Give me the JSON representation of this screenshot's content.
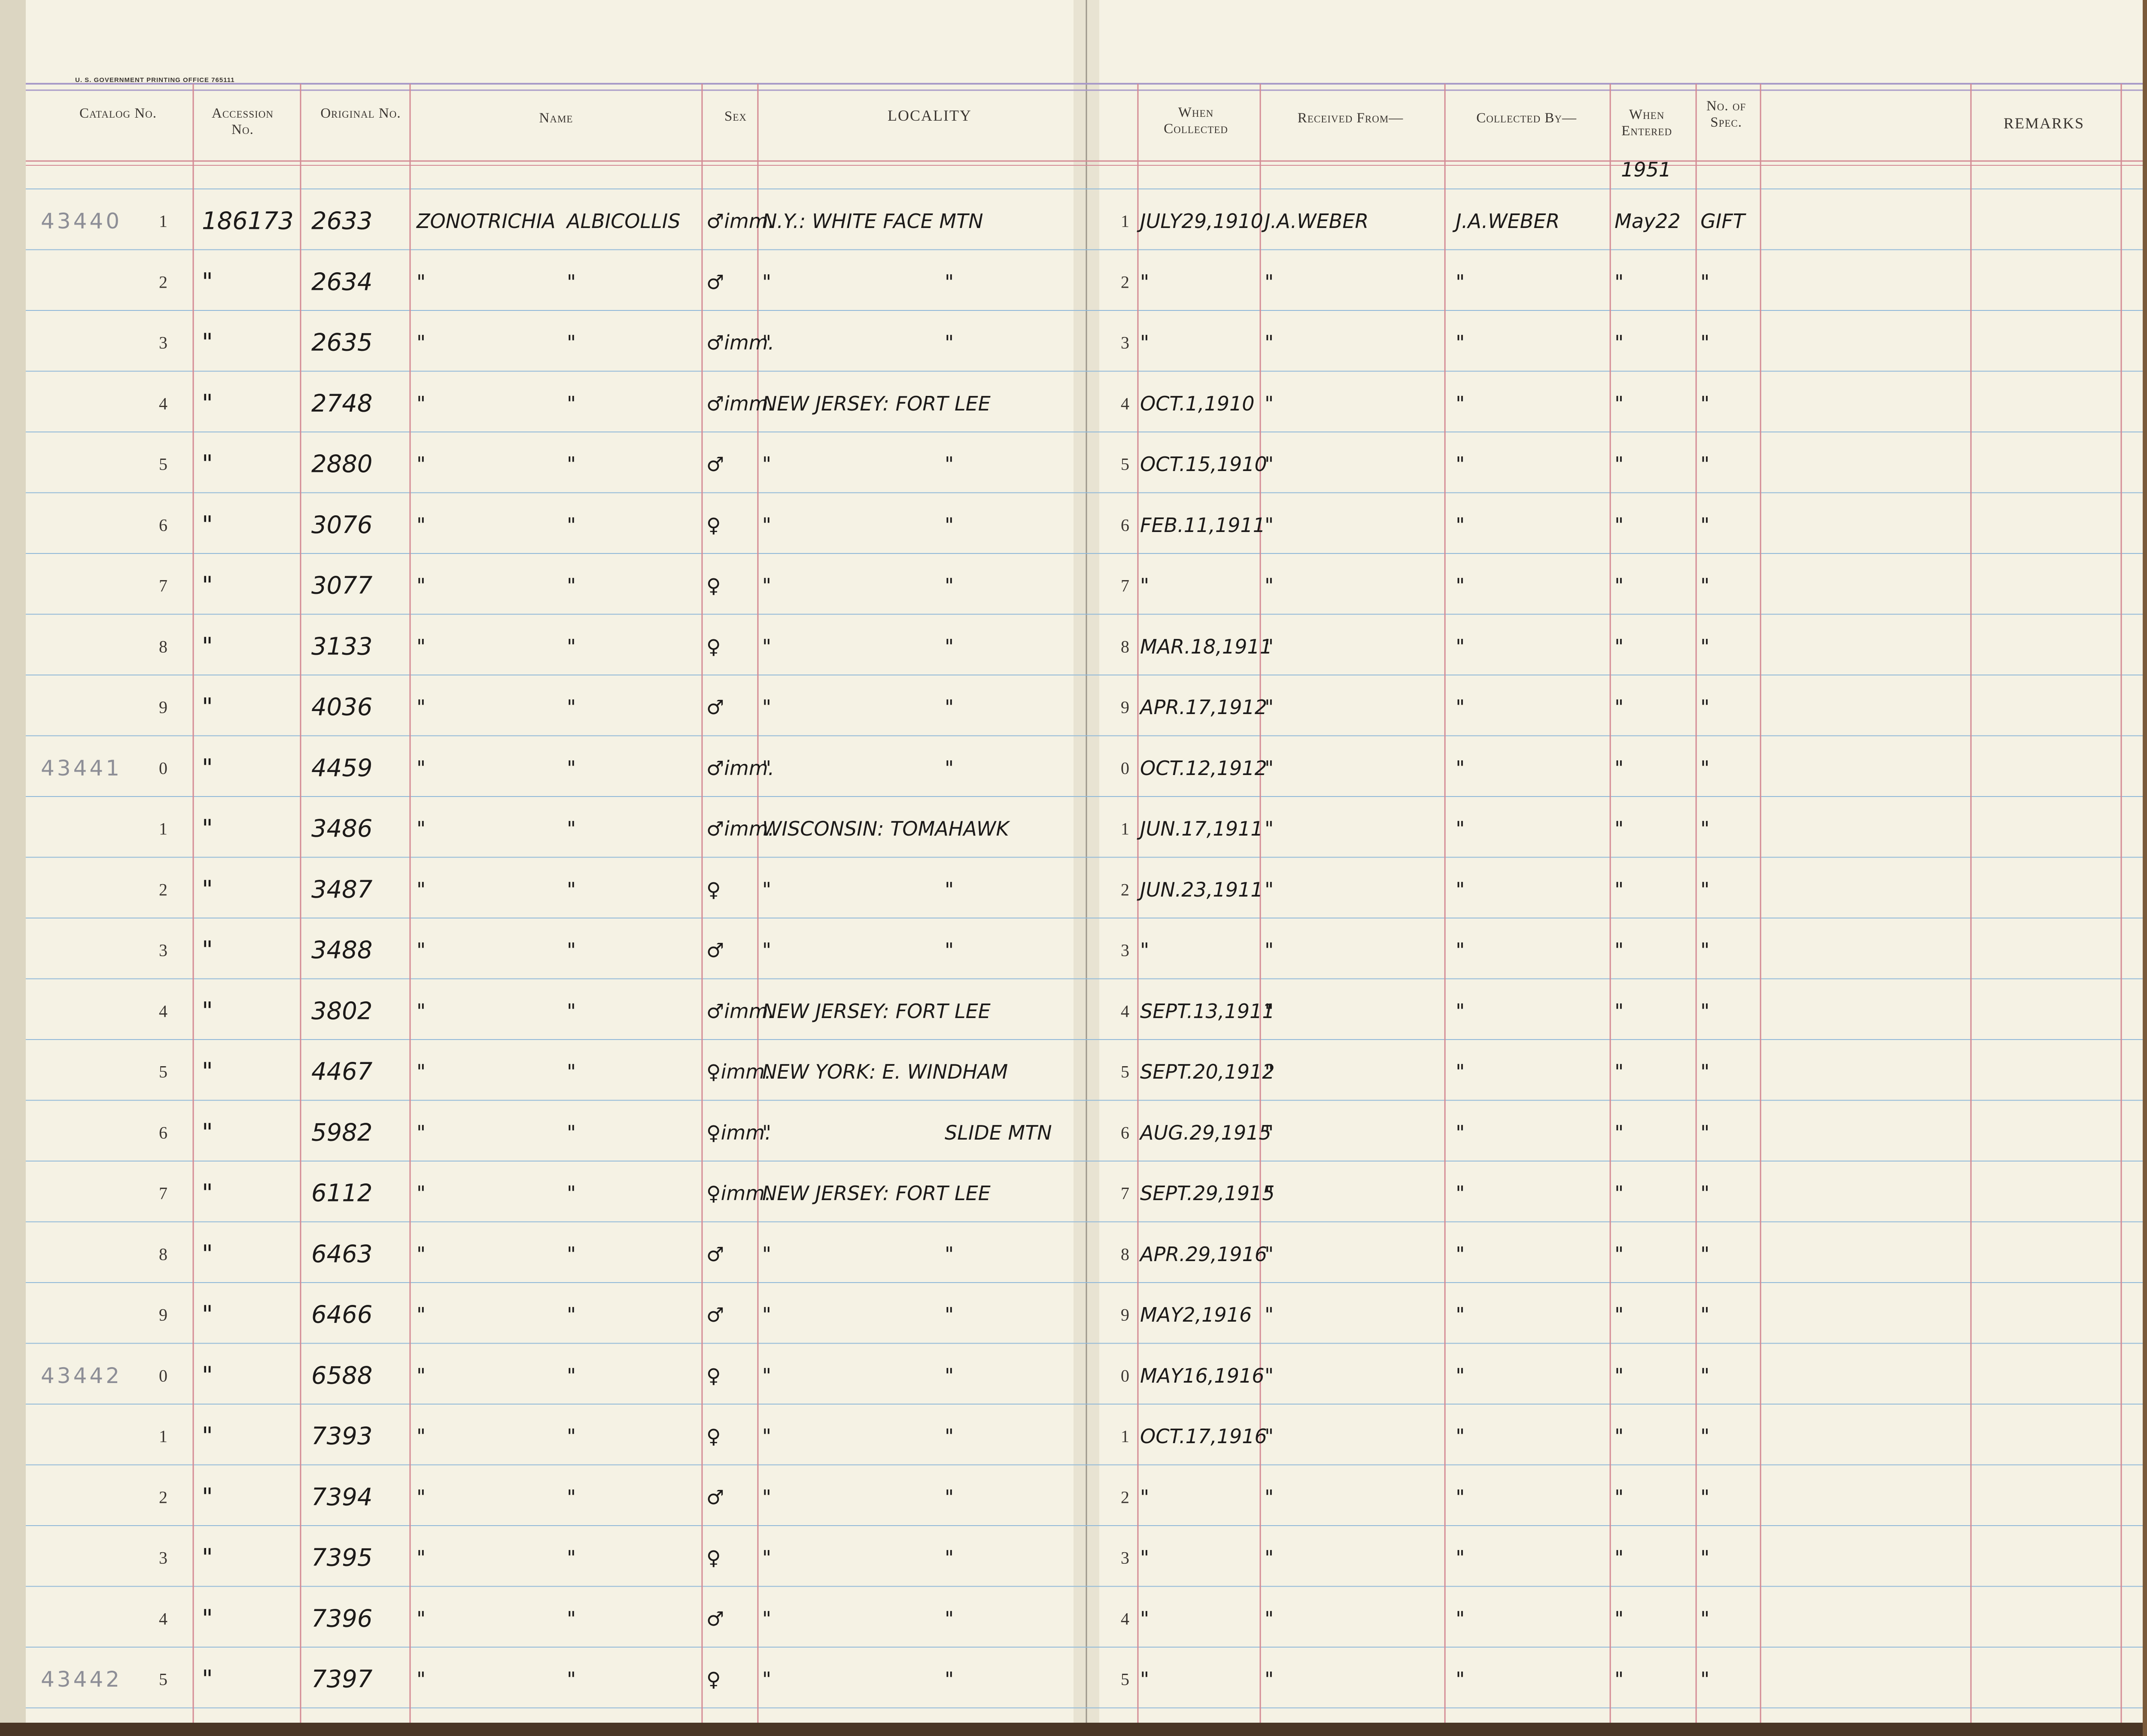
{
  "header": {
    "gpo_imprint": "U. S. GOVERNMENT PRINTING OFFICE    765111",
    "catalog_no": "Catalog No.",
    "accession_no": "Accession No.",
    "original_no": "Original No.",
    "name": "Name",
    "sex": "Sex",
    "locality": "LOCALITY",
    "when_collected": "When Collected",
    "received_from": "Received From—",
    "collected_by": "Collected By—",
    "when_entered": "When Entered",
    "no_of_spec": "No. of Spec.",
    "remarks": "REMARKS"
  },
  "entered_year": "1951",
  "rows": [
    {
      "catalog_prefix": "43440",
      "row_digit": "1",
      "accession": "186173",
      "original": "2633",
      "name_genus": "ZONOTRICHIA",
      "name_species": "ALBICOLLIS",
      "sex": "♂imm.",
      "loc_a": "N.Y.: WHITE FACE MTN",
      "loc_b": "",
      "date_digit": "1",
      "when_collected": "JULY29,1910",
      "received_from": "J.A.WEBER",
      "collected_by": "J.A.WEBER",
      "when_entered": "May22",
      "no_spec": "GIFT"
    },
    {
      "catalog_prefix": "",
      "row_digit": "2",
      "accession": "\"",
      "original": "2634",
      "name_genus": "\"",
      "name_species": "\"",
      "sex": "♂",
      "loc_a": "\"",
      "loc_b": "\"",
      "date_digit": "2",
      "when_collected": "\"",
      "received_from": "\"",
      "collected_by": "\"",
      "when_entered": "\"",
      "no_spec": "\""
    },
    {
      "catalog_prefix": "",
      "row_digit": "3",
      "accession": "\"",
      "original": "2635",
      "name_genus": "\"",
      "name_species": "\"",
      "sex": "♂imm.",
      "loc_a": "\"",
      "loc_b": "\"",
      "date_digit": "3",
      "when_collected": "\"",
      "received_from": "\"",
      "collected_by": "\"",
      "when_entered": "\"",
      "no_spec": "\""
    },
    {
      "catalog_prefix": "",
      "row_digit": "4",
      "accession": "\"",
      "original": "2748",
      "name_genus": "\"",
      "name_species": "\"",
      "sex": "♂imm.",
      "loc_a": "NEW JERSEY: FORT LEE",
      "loc_b": "",
      "date_digit": "4",
      "when_collected": "OCT.1,1910",
      "received_from": "\"",
      "collected_by": "\"",
      "when_entered": "\"",
      "no_spec": "\""
    },
    {
      "catalog_prefix": "",
      "row_digit": "5",
      "accession": "\"",
      "original": "2880",
      "name_genus": "\"",
      "name_species": "\"",
      "sex": "♂",
      "loc_a": "\"",
      "loc_b": "\"",
      "date_digit": "5",
      "when_collected": "OCT.15,1910",
      "received_from": "\"",
      "collected_by": "\"",
      "when_entered": "\"",
      "no_spec": "\""
    },
    {
      "catalog_prefix": "",
      "row_digit": "6",
      "accession": "\"",
      "original": "3076",
      "name_genus": "\"",
      "name_species": "\"",
      "sex": "♀",
      "loc_a": "\"",
      "loc_b": "\"",
      "date_digit": "6",
      "when_collected": "FEB.11,1911",
      "received_from": "\"",
      "collected_by": "\"",
      "when_entered": "\"",
      "no_spec": "\""
    },
    {
      "catalog_prefix": "",
      "row_digit": "7",
      "accession": "\"",
      "original": "3077",
      "name_genus": "\"",
      "name_species": "\"",
      "sex": "♀",
      "loc_a": "\"",
      "loc_b": "\"",
      "date_digit": "7",
      "when_collected": "\"",
      "received_from": "\"",
      "collected_by": "\"",
      "when_entered": "\"",
      "no_spec": "\""
    },
    {
      "catalog_prefix": "",
      "row_digit": "8",
      "accession": "\"",
      "original": "3133",
      "name_genus": "\"",
      "name_species": "\"",
      "sex": "♀",
      "loc_a": "\"",
      "loc_b": "\"",
      "date_digit": "8",
      "when_collected": "MAR.18,1911",
      "received_from": "\"",
      "collected_by": "\"",
      "when_entered": "\"",
      "no_spec": "\""
    },
    {
      "catalog_prefix": "",
      "row_digit": "9",
      "accession": "\"",
      "original": "4036",
      "name_genus": "\"",
      "name_species": "\"",
      "sex": "♂",
      "loc_a": "\"",
      "loc_b": "\"",
      "date_digit": "9",
      "when_collected": "APR.17,1912",
      "received_from": "\"",
      "collected_by": "\"",
      "when_entered": "\"",
      "no_spec": "\""
    },
    {
      "catalog_prefix": "43441",
      "row_digit": "0",
      "accession": "\"",
      "original": "4459",
      "name_genus": "\"",
      "name_species": "\"",
      "sex": "♂imm.",
      "loc_a": "\"",
      "loc_b": "\"",
      "date_digit": "0",
      "when_collected": "OCT.12,1912",
      "received_from": "\"",
      "collected_by": "\"",
      "when_entered": "\"",
      "no_spec": "\""
    },
    {
      "catalog_prefix": "",
      "row_digit": "1",
      "accession": "\"",
      "original": "3486",
      "name_genus": "\"",
      "name_species": "\"",
      "sex": "♂imm.",
      "loc_a": "WISCONSIN: TOMAHAWK",
      "loc_b": "",
      "date_digit": "1",
      "when_collected": "JUN.17,1911",
      "received_from": "\"",
      "collected_by": "\"",
      "when_entered": "\"",
      "no_spec": "\""
    },
    {
      "catalog_prefix": "",
      "row_digit": "2",
      "accession": "\"",
      "original": "3487",
      "name_genus": "\"",
      "name_species": "\"",
      "sex": "♀",
      "loc_a": "\"",
      "loc_b": "\"",
      "date_digit": "2",
      "when_collected": "JUN.23,1911",
      "received_from": "\"",
      "collected_by": "\"",
      "when_entered": "\"",
      "no_spec": "\""
    },
    {
      "catalog_prefix": "",
      "row_digit": "3",
      "accession": "\"",
      "original": "3488",
      "name_genus": "\"",
      "name_species": "\"",
      "sex": "♂",
      "loc_a": "\"",
      "loc_b": "\"",
      "date_digit": "3",
      "when_collected": "\"",
      "received_from": "\"",
      "collected_by": "\"",
      "when_entered": "\"",
      "no_spec": "\""
    },
    {
      "catalog_prefix": "",
      "row_digit": "4",
      "accession": "\"",
      "original": "3802",
      "name_genus": "\"",
      "name_species": "\"",
      "sex": "♂imm.",
      "loc_a": "NEW JERSEY: FORT LEE",
      "loc_b": "",
      "date_digit": "4",
      "when_collected": "SEPT.13,1911",
      "received_from": "\"",
      "collected_by": "\"",
      "when_entered": "\"",
      "no_spec": "\""
    },
    {
      "catalog_prefix": "",
      "row_digit": "5",
      "accession": "\"",
      "original": "4467",
      "name_genus": "\"",
      "name_species": "\"",
      "sex": "♀imm.",
      "loc_a": "NEW YORK: E. WINDHAM",
      "loc_b": "",
      "date_digit": "5",
      "when_collected": "SEPT.20,1912",
      "received_from": "\"",
      "collected_by": "\"",
      "when_entered": "\"",
      "no_spec": "\""
    },
    {
      "catalog_prefix": "",
      "row_digit": "6",
      "accession": "\"",
      "original": "5982",
      "name_genus": "\"",
      "name_species": "\"",
      "sex": "♀imm.",
      "loc_a": "\"",
      "loc_b": "SLIDE MTN",
      "date_digit": "6",
      "when_collected": "AUG.29,1915",
      "received_from": "\"",
      "collected_by": "\"",
      "when_entered": "\"",
      "no_spec": "\""
    },
    {
      "catalog_prefix": "",
      "row_digit": "7",
      "accession": "\"",
      "original": "6112",
      "name_genus": "\"",
      "name_species": "\"",
      "sex": "♀imm.",
      "loc_a": "NEW JERSEY: FORT LEE",
      "loc_b": "",
      "date_digit": "7",
      "when_collected": "SEPT.29,1915",
      "received_from": "\"",
      "collected_by": "\"",
      "when_entered": "\"",
      "no_spec": "\""
    },
    {
      "catalog_prefix": "",
      "row_digit": "8",
      "accession": "\"",
      "original": "6463",
      "name_genus": "\"",
      "name_species": "\"",
      "sex": "♂",
      "loc_a": "\"",
      "loc_b": "\"",
      "date_digit": "8",
      "when_collected": "APR.29,1916",
      "received_from": "\"",
      "collected_by": "\"",
      "when_entered": "\"",
      "no_spec": "\""
    },
    {
      "catalog_prefix": "",
      "row_digit": "9",
      "accession": "\"",
      "original": "6466",
      "name_genus": "\"",
      "name_species": "\"",
      "sex": "♂",
      "loc_a": "\"",
      "loc_b": "\"",
      "date_digit": "9",
      "when_collected": "MAY2,1916",
      "received_from": "\"",
      "collected_by": "\"",
      "when_entered": "\"",
      "no_spec": "\""
    },
    {
      "catalog_prefix": "43442",
      "row_digit": "0",
      "accession": "\"",
      "original": "6588",
      "name_genus": "\"",
      "name_species": "\"",
      "sex": "♀",
      "loc_a": "\"",
      "loc_b": "\"",
      "date_digit": "0",
      "when_collected": "MAY16,1916",
      "received_from": "\"",
      "collected_by": "\"",
      "when_entered": "\"",
      "no_spec": "\""
    },
    {
      "catalog_prefix": "",
      "row_digit": "1",
      "accession": "\"",
      "original": "7393",
      "name_genus": "\"",
      "name_species": "\"",
      "sex": "♀",
      "loc_a": "\"",
      "loc_b": "\"",
      "date_digit": "1",
      "when_collected": "OCT.17,1916",
      "received_from": "\"",
      "collected_by": "\"",
      "when_entered": "\"",
      "no_spec": "\""
    },
    {
      "catalog_prefix": "",
      "row_digit": "2",
      "accession": "\"",
      "original": "7394",
      "name_genus": "\"",
      "name_species": "\"",
      "sex": "♂",
      "loc_a": "\"",
      "loc_b": "\"",
      "date_digit": "2",
      "when_collected": "\"",
      "received_from": "\"",
      "collected_by": "\"",
      "when_entered": "\"",
      "no_spec": "\""
    },
    {
      "catalog_prefix": "",
      "row_digit": "3",
      "accession": "\"",
      "original": "7395",
      "name_genus": "\"",
      "name_species": "\"",
      "sex": "♀",
      "loc_a": "\"",
      "loc_b": "\"",
      "date_digit": "3",
      "when_collected": "\"",
      "received_from": "\"",
      "collected_by": "\"",
      "when_entered": "\"",
      "no_spec": "\""
    },
    {
      "catalog_prefix": "",
      "row_digit": "4",
      "accession": "\"",
      "original": "7396",
      "name_genus": "\"",
      "name_species": "\"",
      "sex": "♂",
      "loc_a": "\"",
      "loc_b": "\"",
      "date_digit": "4",
      "when_collected": "\"",
      "received_from": "\"",
      "collected_by": "\"",
      "when_entered": "\"",
      "no_spec": "\""
    },
    {
      "catalog_prefix": "43442",
      "row_digit": "5",
      "accession": "\"",
      "original": "7397",
      "name_genus": "\"",
      "name_species": "\"",
      "sex": "♀",
      "loc_a": "\"",
      "loc_b": "\"",
      "date_digit": "5",
      "when_collected": "\"",
      "received_from": "\"",
      "collected_by": "\"",
      "when_entered": "\"",
      "no_spec": "\""
    }
  ],
  "colors": {
    "paper": "#f5f2e4",
    "blue_rule": "#8fb8d8",
    "red_rule": "#d48a94",
    "header_rule": "#a89ac8",
    "ink": "#1c1a19",
    "pencil": "#8d8e96"
  }
}
